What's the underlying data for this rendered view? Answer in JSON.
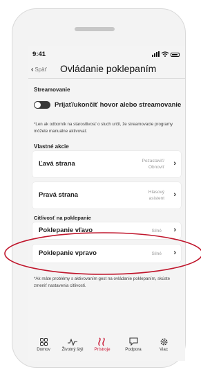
{
  "status": {
    "time": "9:41"
  },
  "nav": {
    "back_label": "Späť",
    "title": "Ovládanie poklepaním"
  },
  "streaming": {
    "section_title": "Streamovanie",
    "toggle_label": "Prijať/ukončiť hovor alebo streamovanie",
    "note": "*Len ak odborník na starostlivosť o sluch určil, že streamovacie programy môžete manuálne aktivovať."
  },
  "custom_actions": {
    "section_title": "Vlastné akcie",
    "items": [
      {
        "label": "Ľavá strana",
        "value": "Pozastaviť/ Obnoviť"
      },
      {
        "label": "Pravá strana",
        "value": "Hlasový asistent"
      }
    ]
  },
  "sensitivity": {
    "section_title": "Citlivosť na poklepanie",
    "items": [
      {
        "label": "Poklepanie vľavo",
        "value": "Silné"
      },
      {
        "label": "Poklepanie vpravo",
        "value": "Silné"
      }
    ],
    "note": "*Ak máte problémy s aktivovaním gest na ovládanie poklepaním, skúste zmeniť nastavenia citlivosti."
  },
  "tabbar": {
    "items": [
      {
        "label": "Domov",
        "icon": "home-grid-icon"
      },
      {
        "label": "Životný štýl",
        "icon": "activity-icon"
      },
      {
        "label": "Prístroje",
        "icon": "hearing-aid-icon",
        "active": true
      },
      {
        "label": "Podpora",
        "icon": "chat-bubble-icon"
      },
      {
        "label": "Viac",
        "icon": "gear-icon"
      }
    ]
  },
  "colors": {
    "accent": "#c8102e",
    "highlight_ring": "#c0162c"
  }
}
